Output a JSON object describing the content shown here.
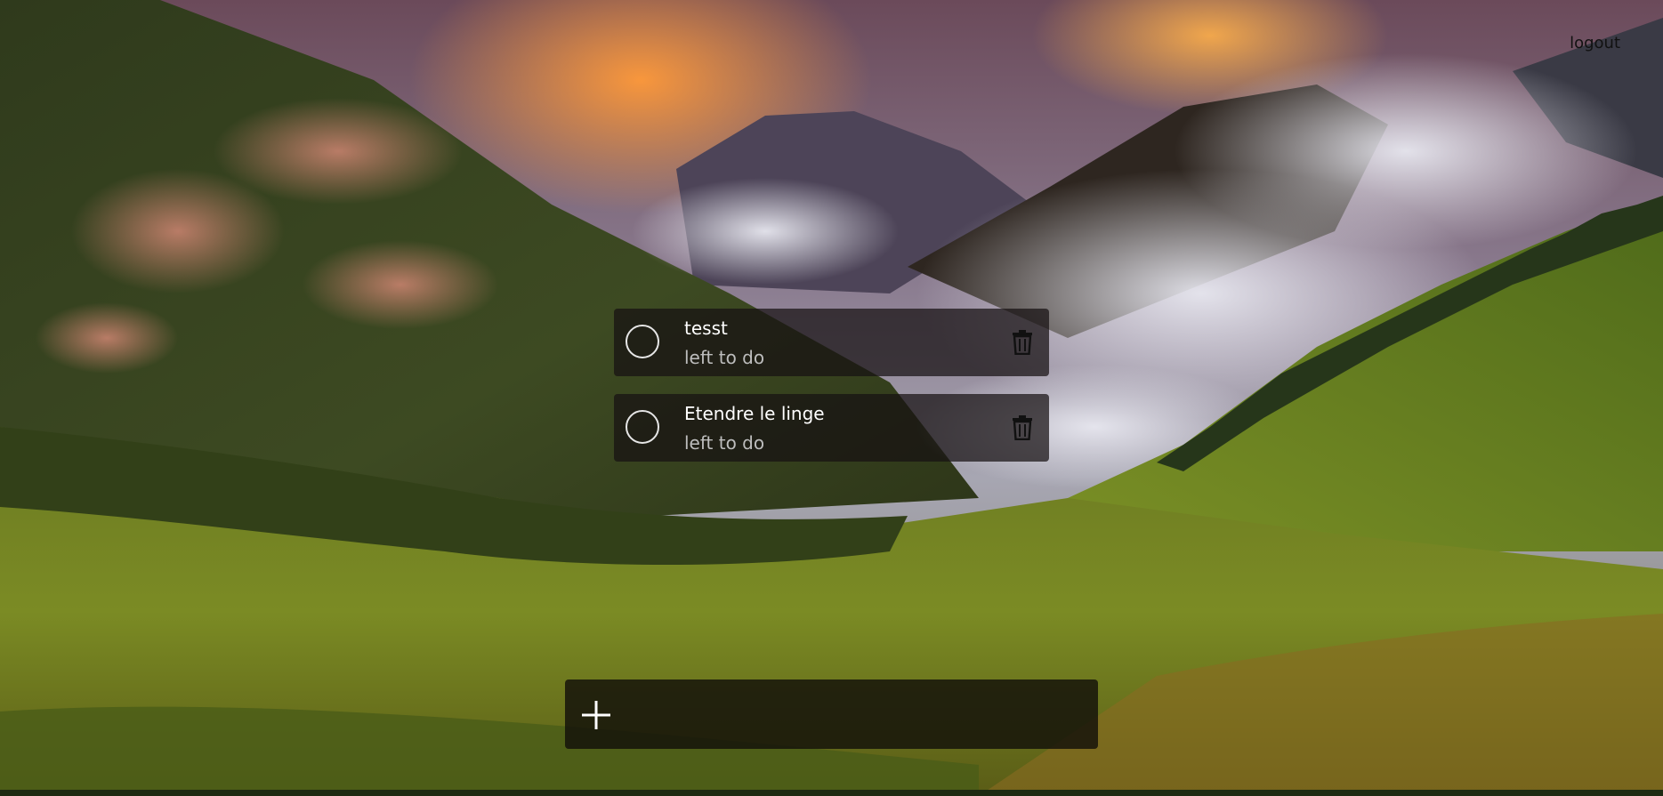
{
  "header": {
    "logout_label": "logout"
  },
  "tasks": [
    {
      "title": "tesst",
      "status": "left to do",
      "done": false
    },
    {
      "title": "Etendre le linge",
      "status": "left to do",
      "done": false
    }
  ],
  "add_task": {
    "placeholder": "",
    "value": ""
  },
  "icons": {
    "toggle": "circle-checkbox-icon",
    "delete": "trash-icon",
    "add": "plus-icon"
  },
  "colors": {
    "card_bg": "#161012",
    "text_primary": "#ffffff",
    "text_secondary": "#bdbdbd",
    "add_bar_bg": "#12100a"
  }
}
